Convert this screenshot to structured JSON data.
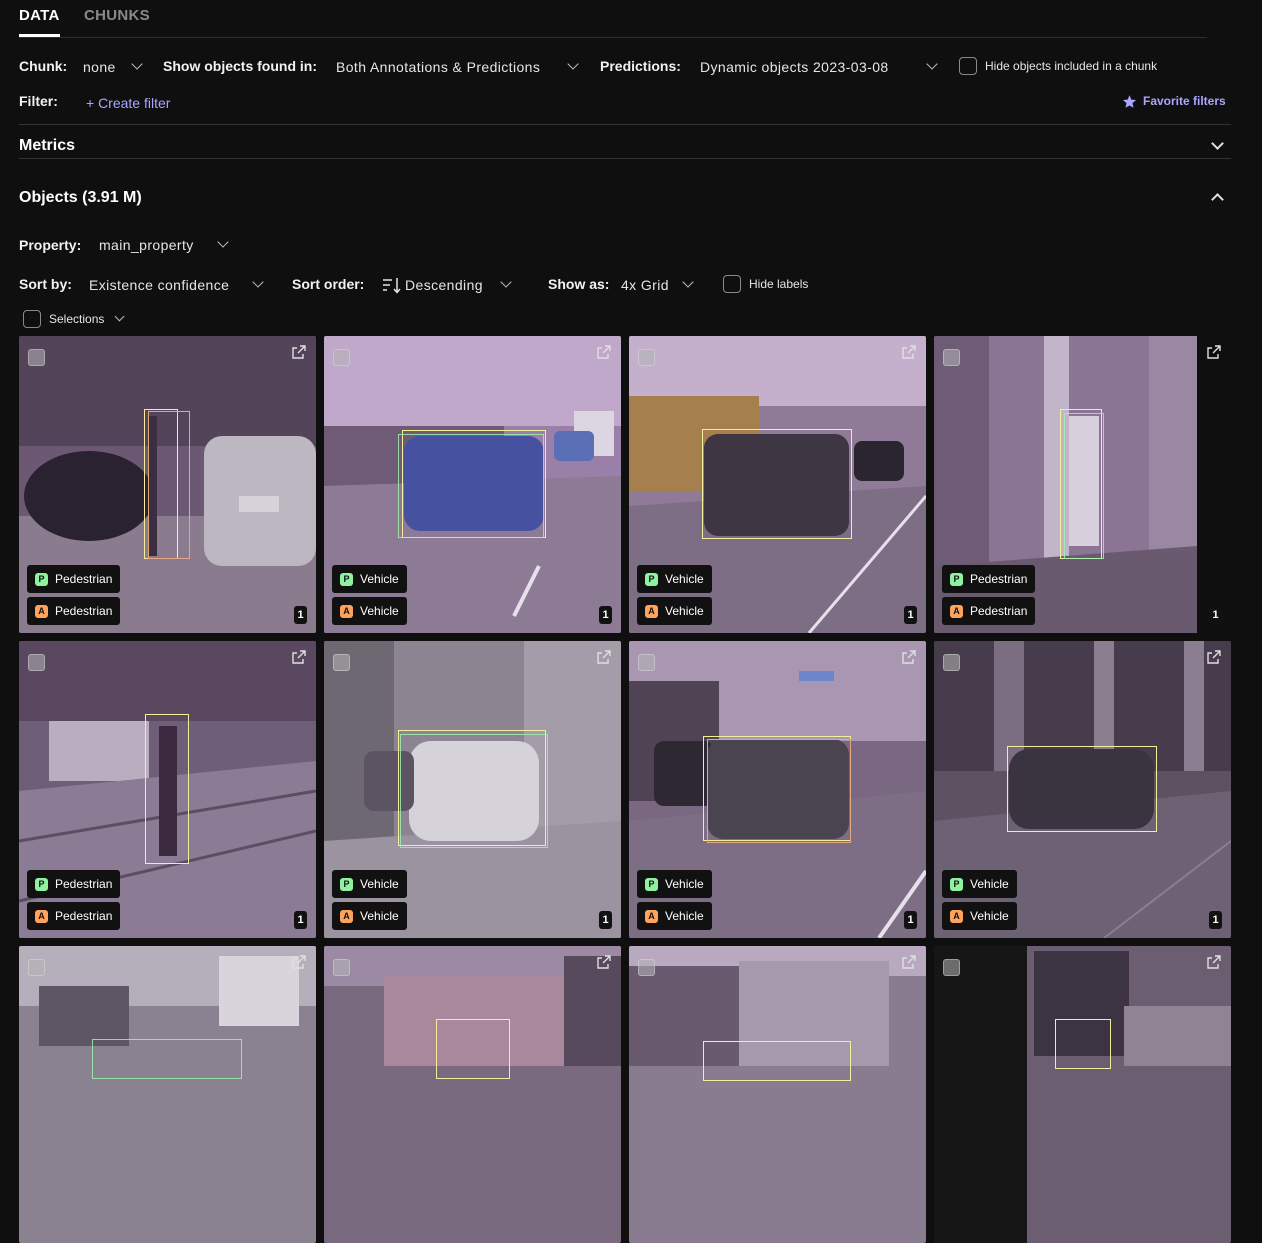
{
  "tabs": [
    {
      "label": "DATA",
      "active": true
    },
    {
      "label": "CHUNKS",
      "active": false
    }
  ],
  "filters": {
    "chunk_label": "Chunk:",
    "chunk_value": "none",
    "show_objects_label": "Show objects found in:",
    "show_objects_value": "Both Annotations & Predictions",
    "predictions_label": "Predictions:",
    "predictions_value": "Dynamic objects 2023-03-08",
    "hide_chunk_label": "Hide objects included in a chunk",
    "filter_label": "Filter:",
    "create_filter": "+ Create filter",
    "favorite_filters": "Favorite filters"
  },
  "metrics": {
    "title": "Metrics"
  },
  "objects": {
    "title": "Objects (3.91 M)",
    "property_label": "Property:",
    "property_value": "main_property",
    "sort_by_label": "Sort by:",
    "sort_by_value": "Existence confidence",
    "sort_order_label": "Sort order:",
    "sort_order_value": "Descending",
    "show_as_label": "Show as:",
    "show_as_value": "4x Grid",
    "hide_labels": "Hide labels",
    "selections": "Selections"
  },
  "cards": [
    {
      "pred": "Pedestrian",
      "annot": "Pedestrian",
      "count": "1",
      "p": "P",
      "a": "A"
    },
    {
      "pred": "Vehicle",
      "annot": "Vehicle",
      "count": "1",
      "p": "P",
      "a": "A"
    },
    {
      "pred": "Vehicle",
      "annot": "Vehicle",
      "count": "1",
      "p": "P",
      "a": "A"
    },
    {
      "pred": "Pedestrian",
      "annot": "Pedestrian",
      "count": "1",
      "p": "P",
      "a": "A"
    },
    {
      "pred": "Pedestrian",
      "annot": "Pedestrian",
      "count": "1",
      "p": "P",
      "a": "A"
    },
    {
      "pred": "Vehicle",
      "annot": "Vehicle",
      "count": "1",
      "p": "P",
      "a": "A"
    },
    {
      "pred": "Vehicle",
      "annot": "Vehicle",
      "count": "1",
      "p": "P",
      "a": "A"
    },
    {
      "pred": "Vehicle",
      "annot": "Vehicle",
      "count": "1",
      "p": "P",
      "a": "A"
    }
  ],
  "colors": {
    "accent": "#a9a6ff",
    "bbox_yellow": "#f3ee9c",
    "prediction_badge": "#8ef2a0",
    "annotation_badge": "#ffa25c"
  }
}
